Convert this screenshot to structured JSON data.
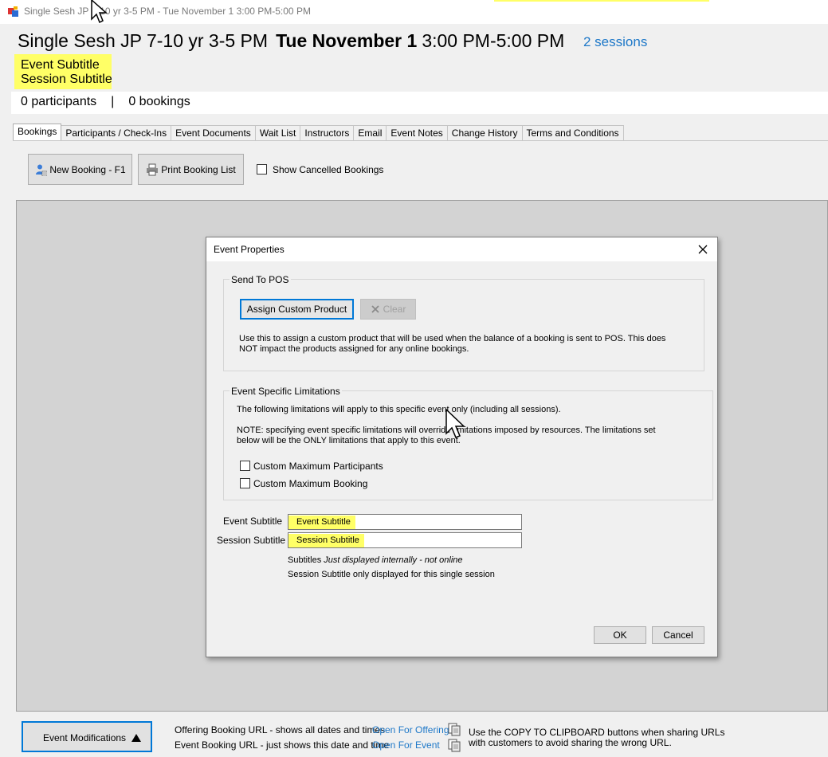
{
  "window": {
    "title": "Single Sesh JP 7-10 yr 3-5 PM - Tue November 1 3:00 PM-5:00 PM",
    "icon": "app-window-icon"
  },
  "header": {
    "event_name": "Single Sesh JP 7-10 yr 3-5 PM",
    "date": "Tue November 1",
    "time": "3:00 PM-5:00 PM",
    "sessions_link": "2 sessions",
    "event_subtitle": "Event Subtitle",
    "session_subtitle": "Session Subtitle",
    "participants": "0 participants",
    "separator": "|",
    "bookings": "0 bookings"
  },
  "tabs": [
    {
      "label": "Bookings",
      "active": true
    },
    {
      "label": "Participants / Check-Ins"
    },
    {
      "label": "Event Documents"
    },
    {
      "label": "Wait List"
    },
    {
      "label": "Instructors"
    },
    {
      "label": "Email"
    },
    {
      "label": "Event Notes"
    },
    {
      "label": "Change History"
    },
    {
      "label": "Terms and Conditions"
    }
  ],
  "toolbar": {
    "new_booking": "New Booking - F1",
    "print_booking_list": "Print Booking List",
    "show_cancelled": "Show Cancelled Bookings",
    "show_cancelled_checked": false
  },
  "dialog": {
    "title": "Event Properties",
    "close_icon": "close-icon",
    "send_to_pos": {
      "legend": "Send To POS",
      "assign_button": "Assign Custom Product",
      "clear_button": "Clear",
      "description_line1": "Use this to assign a custom product that will be used when the balance of a booking is sent to POS.  This does",
      "description_line2": "NOT impact the products assigned for any online bookings."
    },
    "limitations": {
      "legend": "Event Specific Limitations",
      "intro": "The following limitations will apply to this specific event only (including all sessions).",
      "note_line1": "NOTE:  specifying event specific limitations will override    limitations imposed by resources.   The limitations set",
      "note_line2": "below will be the ONLY limitations that apply to this event.",
      "custom_max_participants": "Custom Maximum Participants",
      "custom_max_booking": "Custom Maximum Booking"
    },
    "fields": {
      "event_subtitle_label": "Event Subtitle",
      "event_subtitle_value": "Event Subtitle",
      "session_subtitle_label": "Session Subtitle",
      "session_subtitle_value": "Session Subtitle"
    },
    "hint": {
      "prefix": "Subtitles ",
      "italic": "Just displayed internally - not online",
      "line2": "Session Subtitle only displayed for this single session"
    },
    "ok_button": "OK",
    "cancel_button": "Cancel"
  },
  "bottom": {
    "event_modifications": "Event Modifications",
    "offering_label": "Offering Booking URL - shows all dates and times",
    "offering_link": "Open For Offering",
    "event_label": "Event Booking URL - just shows this date and time",
    "event_link": "Open For Event",
    "hint": "Use the COPY TO CLIPBOARD buttons when sharing URLs with customers to avoid sharing the wrong URL."
  },
  "colors": {
    "highlight": "#ffff66",
    "link": "#1e78c8",
    "focus": "#0078d7"
  }
}
